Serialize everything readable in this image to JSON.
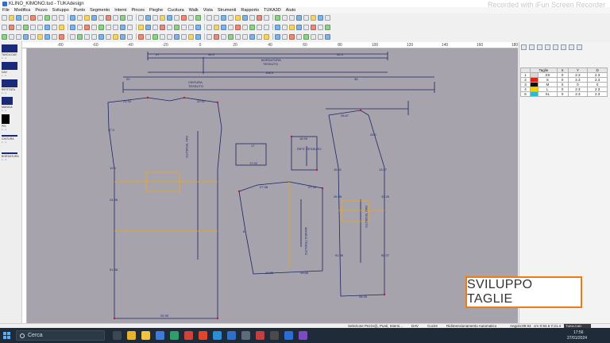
{
  "window": {
    "title": "KLINO_KIMONO.tud - TUKAdesign",
    "watermark": "Recorded with iFun Screen Recorder"
  },
  "menu": [
    "File",
    "Modifica",
    "Pezzo",
    "Sviluppo",
    "Punto",
    "Segmento",
    "Interni",
    "Pinces",
    "Pieghe",
    "Cucitura",
    "Walk",
    "Vista",
    "Strumenti",
    "Rapporto",
    "TUKA3D",
    "Aiuto"
  ],
  "pieces": [
    {
      "name": "TASCA DAV",
      "sub": "1 - 1",
      "shape": "wide"
    },
    {
      "name": "DAV",
      "sub": "1 - 1",
      "shape": "wide"
    },
    {
      "name": "RIFITTATA",
      "sub": "1 - 1",
      "shape": "wide"
    },
    {
      "name": "MANICA",
      "sub": "1 - 1",
      "shape": "sleeve"
    },
    {
      "name": "PIS",
      "sub": "1 - 1",
      "shape": "dark"
    },
    {
      "name": "CINTURA",
      "sub": "1 - 1",
      "shape": "line"
    },
    {
      "name": "BORDATURA",
      "sub": "1 - 2",
      "shape": "line"
    }
  ],
  "ruler": {
    "ticks": [
      "-80",
      "-60",
      "-40",
      "-20",
      "0",
      "20",
      "40",
      "60",
      "80",
      "100",
      "120",
      "140",
      "160",
      "180"
    ]
  },
  "canvas_labels": {
    "bordatura": "BORDATURA",
    "bordatura_sub": "TESSUTO",
    "cintura": "CINTURA",
    "cintura_sub": "TESSUTO",
    "dav_main": "DAV TESSUTO",
    "dav_main2": "DAV TESSUTO",
    "tasca": "TASCA DAV TESSUTO",
    "manica": "MANICA TESSUTO",
    "rifit": "RIFIT. TESSUTO",
    "m1": "27",
    "m2": "46.9",
    "m3": "52.3",
    "m4": "108.3",
    "m5": "20",
    "m6": "36",
    "m7": "21.33",
    "m8": "22.33",
    "m9": "27.3",
    "m10": "12.6",
    "m11": "24.98",
    "m12": "51.38",
    "m13": "25.35",
    "m14": "17",
    "m15": "16.99",
    "m16": "17.02",
    "m17": "27.38",
    "m18": "27.33",
    "m19": "19.86",
    "m20": "19.66",
    "m21": "8",
    "m22": "26.67",
    "m23": "26.2",
    "m24": "51.36",
    "m25": "50.37",
    "m26": "26.25",
    "m27": "15.41",
    "m28": "13.57",
    "m29": "31.26",
    "m30": "26.98"
  },
  "sizes_table": {
    "headers": [
      "",
      "Taglie",
      "X",
      "Y",
      "D"
    ],
    "rows": [
      {
        "idx": "1",
        "name": "XS",
        "swatch": "#d8d8d8",
        "x": "0",
        "y": "2.3",
        "d": "2.3"
      },
      {
        "idx": "2",
        "name": "S",
        "swatch": "#d8261e",
        "x": "0",
        "y": "2.3",
        "d": "2.3"
      },
      {
        "idx": "3",
        "name": "M",
        "swatch": "#111111",
        "x": "0",
        "y": "0",
        "d": "0"
      },
      {
        "idx": "4",
        "name": "L",
        "swatch": "#f2d000",
        "x": "0",
        "y": "2.3",
        "d": "2.3"
      },
      {
        "idx": "5",
        "name": "XL",
        "swatch": "#2fb7d8",
        "x": "0",
        "y": "2.3",
        "d": "2.3"
      }
    ]
  },
  "status": {
    "hint": "Selezione Pezzo(i), Punti, Interni...",
    "mode1": "DAV",
    "mode2": "Cucire",
    "mode3": "Ridimensionamento Automatico",
    "angle": "Angolo:89.93",
    "coords": "cm  X:94.5  Y:21.4",
    "logo": "TUKA CAD"
  },
  "overlay": {
    "text": "SVILUPPO TAGLIE"
  },
  "taskbar": {
    "search_placeholder": "Cerca",
    "time": "17:56",
    "date": "27/01/2024"
  },
  "colors": {
    "canvas": "#a7a3ad",
    "accent": "#f07a18",
    "pattern_line": "#1b2461",
    "grading": "#f2a900"
  }
}
